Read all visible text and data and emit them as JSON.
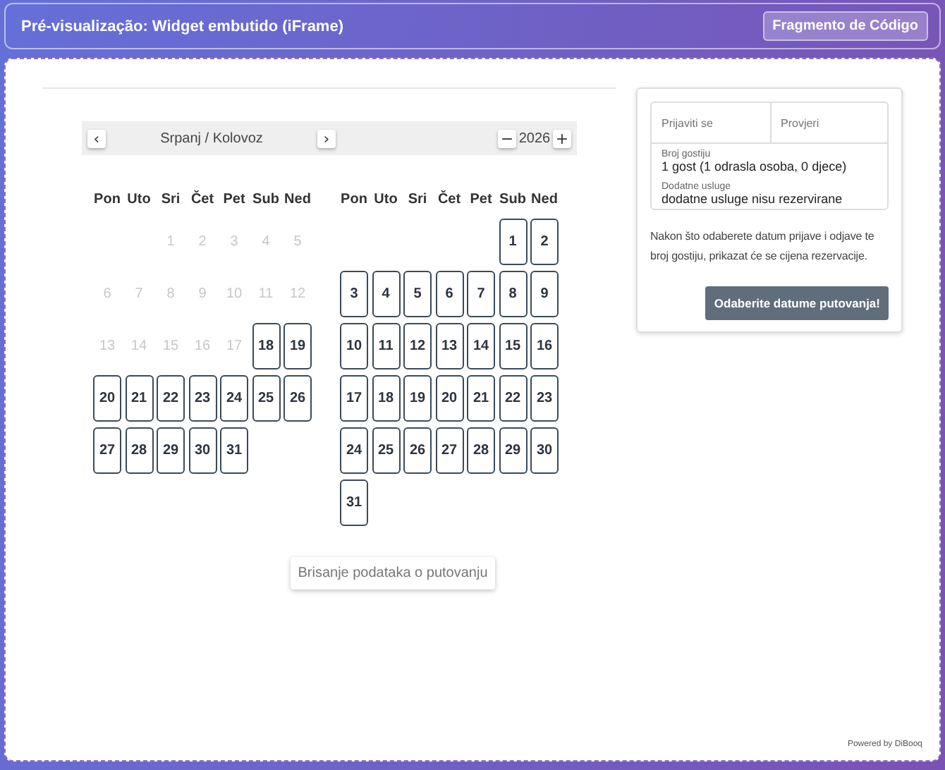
{
  "header": {
    "title": "Pré-visualização: Widget embutido (iFrame)",
    "button": "Fragmento de Código"
  },
  "navigator": {
    "prev": "‹",
    "month_label": "Srpanj / Kolovoz",
    "next": "›",
    "year_minus": "−",
    "year": "2026",
    "year_plus": "+"
  },
  "months": [
    {
      "weekdays": [
        "Pon",
        "Uto",
        "Sri",
        "Čet",
        "Pet",
        "Sub",
        "Ned"
      ],
      "weeks": [
        [
          {
            "kind": "blank"
          },
          {
            "kind": "blank"
          },
          {
            "kind": "day",
            "day": "1",
            "available": false
          },
          {
            "kind": "day",
            "day": "2",
            "available": false
          },
          {
            "kind": "day",
            "day": "3",
            "available": false
          },
          {
            "kind": "day",
            "day": "4",
            "available": false
          },
          {
            "kind": "day",
            "day": "5",
            "available": false
          }
        ],
        [
          {
            "kind": "day",
            "day": "6",
            "available": false
          },
          {
            "kind": "day",
            "day": "7",
            "available": false
          },
          {
            "kind": "day",
            "day": "8",
            "available": false
          },
          {
            "kind": "day",
            "day": "9",
            "available": false
          },
          {
            "kind": "day",
            "day": "10",
            "available": false
          },
          {
            "kind": "day",
            "day": "11",
            "available": false
          },
          {
            "kind": "day",
            "day": "12",
            "available": false
          }
        ],
        [
          {
            "kind": "day",
            "day": "13",
            "available": false
          },
          {
            "kind": "day",
            "day": "14",
            "available": false
          },
          {
            "kind": "day",
            "day": "15",
            "available": false
          },
          {
            "kind": "day",
            "day": "16",
            "available": false
          },
          {
            "kind": "day",
            "day": "17",
            "available": false
          },
          {
            "kind": "day",
            "day": "18",
            "available": true
          },
          {
            "kind": "day",
            "day": "19",
            "available": true
          }
        ],
        [
          {
            "kind": "day",
            "day": "20",
            "available": true
          },
          {
            "kind": "day",
            "day": "21",
            "available": true
          },
          {
            "kind": "day",
            "day": "22",
            "available": true
          },
          {
            "kind": "day",
            "day": "23",
            "available": true
          },
          {
            "kind": "day",
            "day": "24",
            "available": true
          },
          {
            "kind": "day",
            "day": "25",
            "available": true
          },
          {
            "kind": "day",
            "day": "26",
            "available": true
          }
        ],
        [
          {
            "kind": "day",
            "day": "27",
            "available": true
          },
          {
            "kind": "day",
            "day": "28",
            "available": true
          },
          {
            "kind": "day",
            "day": "29",
            "available": true
          },
          {
            "kind": "day",
            "day": "30",
            "available": true
          },
          {
            "kind": "day",
            "day": "31",
            "available": true
          }
        ]
      ]
    },
    {
      "weekdays": [
        "Pon",
        "Uto",
        "Sri",
        "Čet",
        "Pet",
        "Sub",
        "Ned"
      ],
      "weeks": [
        [
          {
            "kind": "blank"
          },
          {
            "kind": "blank"
          },
          {
            "kind": "blank"
          },
          {
            "kind": "blank"
          },
          {
            "kind": "blank"
          },
          {
            "kind": "day",
            "day": "1",
            "available": true
          },
          {
            "kind": "day",
            "day": "2",
            "available": true
          }
        ],
        [
          {
            "kind": "day",
            "day": "3",
            "available": true
          },
          {
            "kind": "day",
            "day": "4",
            "available": true
          },
          {
            "kind": "day",
            "day": "5",
            "available": true
          },
          {
            "kind": "day",
            "day": "6",
            "available": true
          },
          {
            "kind": "day",
            "day": "7",
            "available": true
          },
          {
            "kind": "day",
            "day": "8",
            "available": true
          },
          {
            "kind": "day",
            "day": "9",
            "available": true
          }
        ],
        [
          {
            "kind": "day",
            "day": "10",
            "available": true
          },
          {
            "kind": "day",
            "day": "11",
            "available": true
          },
          {
            "kind": "day",
            "day": "12",
            "available": true
          },
          {
            "kind": "day",
            "day": "13",
            "available": true
          },
          {
            "kind": "day",
            "day": "14",
            "available": true
          },
          {
            "kind": "day",
            "day": "15",
            "available": true
          },
          {
            "kind": "day",
            "day": "16",
            "available": true
          }
        ],
        [
          {
            "kind": "day",
            "day": "17",
            "available": true
          },
          {
            "kind": "day",
            "day": "18",
            "available": true
          },
          {
            "kind": "day",
            "day": "19",
            "available": true
          },
          {
            "kind": "day",
            "day": "20",
            "available": true
          },
          {
            "kind": "day",
            "day": "21",
            "available": true
          },
          {
            "kind": "day",
            "day": "22",
            "available": true
          },
          {
            "kind": "day",
            "day": "23",
            "available": true
          }
        ],
        [
          {
            "kind": "day",
            "day": "24",
            "available": true
          },
          {
            "kind": "day",
            "day": "25",
            "available": true
          },
          {
            "kind": "day",
            "day": "26",
            "available": true
          },
          {
            "kind": "day",
            "day": "27",
            "available": true
          },
          {
            "kind": "day",
            "day": "28",
            "available": true
          },
          {
            "kind": "day",
            "day": "29",
            "available": true
          },
          {
            "kind": "day",
            "day": "30",
            "available": true
          }
        ],
        [
          {
            "kind": "day",
            "day": "31",
            "available": true
          }
        ]
      ]
    }
  ],
  "clear_button": "Brisanje podataka o putovanju",
  "booking": {
    "check_in": {
      "placeholder": "Prijaviti se"
    },
    "check_out": {
      "placeholder": "Provjeri"
    },
    "guests": {
      "label": "Broj gostiju",
      "value": "1 gost (1 odrasla osoba, 0 djece)"
    },
    "extras": {
      "label": "Dodatne usluge",
      "value": "dodatne usluge nisu rezervirane"
    },
    "note": "Nakon što odaberete datum prijave i odjave te broj gostiju, prikazat će se cijena rezervacije.",
    "button": "Odaberite datume putovanja!"
  },
  "footer": "Powered by DiBooq"
}
